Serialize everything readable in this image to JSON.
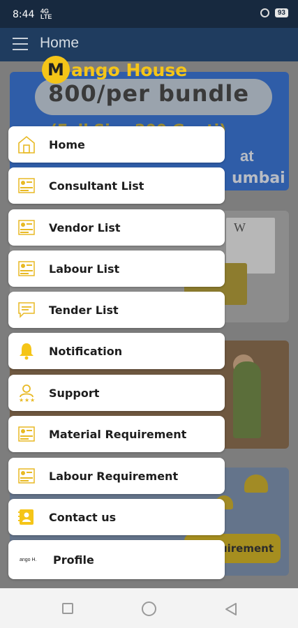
{
  "status_bar": {
    "time": "8:44",
    "net_line1": "4G",
    "net_line2": "LTE",
    "battery": "93"
  },
  "app_bar": {
    "title": "Home"
  },
  "logo": {
    "mark": "M",
    "text": "ango House"
  },
  "background": {
    "banner_price": "800/per bundle",
    "banner_sub": "(Full Size 200 Gunti)",
    "banner_at": "at",
    "banner_city": "umbai",
    "card2_doc": "W",
    "card4_button": "quirement"
  },
  "drawer": {
    "items": [
      {
        "label": "Home",
        "icon": "home-icon"
      },
      {
        "label": "Consultant List",
        "icon": "list-icon"
      },
      {
        "label": "Vendor List",
        "icon": "list-icon"
      },
      {
        "label": "Labour List",
        "icon": "list-icon"
      },
      {
        "label": "Tender List",
        "icon": "tender-icon"
      },
      {
        "label": "Notification",
        "icon": "bell-icon"
      },
      {
        "label": "Support",
        "icon": "support-icon"
      },
      {
        "label": "Material Requirement",
        "icon": "list-icon"
      },
      {
        "label": "Labour Requirement",
        "icon": "list-icon"
      },
      {
        "label": "Contact us",
        "icon": "contact-icon"
      },
      {
        "label": "Profile",
        "icon": "profile-logo",
        "mini_logo": "ango H."
      }
    ]
  },
  "colors": {
    "accent": "#f5c518",
    "app_bar": "#1f3c5f",
    "status_bar": "#17293f"
  }
}
